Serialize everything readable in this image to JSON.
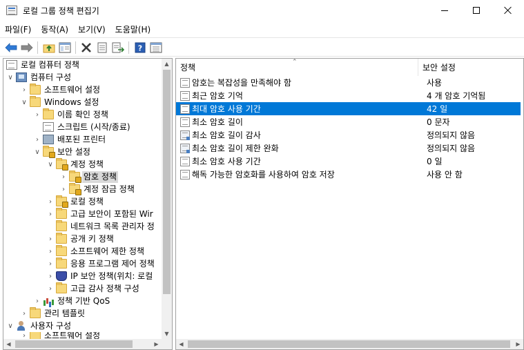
{
  "window": {
    "title": "로컬 그룹 정책 편집기",
    "icon": "group-policy-editor-icon",
    "controls": [
      "minimize-icon",
      "maximize-icon",
      "close-icon"
    ]
  },
  "menu": [
    "파일(F)",
    "동작(A)",
    "보기(V)",
    "도움말(H)"
  ],
  "toolbar": {
    "icons": [
      "back-arrow-icon",
      "forward-arrow-icon",
      "up-folder-icon",
      "show-hide-tree-icon",
      "delete-icon",
      "properties-icon",
      "export-list-icon",
      "help-icon",
      "view-icon"
    ],
    "colors": {
      "back": "#2f7ad6",
      "forward": "#7f7f7f",
      "delete": "#3a3a3a",
      "help": "#2b5fb4"
    }
  },
  "tree": [
    {
      "label": "로컬 컴퓨터 정책",
      "icon": "policy-document-icon",
      "arrow": ""
    },
    {
      "label": "컴퓨터 구성",
      "icon": "computer-icon",
      "arrow": "expanded"
    },
    {
      "label": "소프트웨어 설정",
      "icon": "folder-icon",
      "arrow": "collapsed"
    },
    {
      "label": "Windows 설정",
      "icon": "folder-icon",
      "arrow": "expanded"
    },
    {
      "label": "이름 확인 정책",
      "icon": "folder-icon",
      "arrow": "collapsed"
    },
    {
      "label": "스크립트 (시작/종료)",
      "icon": "script-document-icon",
      "arrow": ""
    },
    {
      "label": "배포된 프린터",
      "icon": "printer-icon",
      "arrow": "collapsed"
    },
    {
      "label": "보안 설정",
      "icon": "security-folder-icon",
      "arrow": "expanded"
    },
    {
      "label": "계정 정책",
      "icon": "locked-folder-icon",
      "arrow": "expanded"
    },
    {
      "label": "암호 정책",
      "icon": "locked-folder-icon",
      "arrow": "collapsed",
      "selected": true
    },
    {
      "label": "계정 잠금 정책",
      "icon": "locked-folder-icon",
      "arrow": "collapsed"
    },
    {
      "label": "로컬 정책",
      "icon": "locked-folder-icon",
      "arrow": "collapsed"
    },
    {
      "label": "고급 보안이 포함된 Wir",
      "icon": "folder-icon",
      "arrow": "collapsed"
    },
    {
      "label": "네트워크 목록 관리자 정",
      "icon": "folder-icon",
      "arrow": ""
    },
    {
      "label": "공개 키 정책",
      "icon": "folder-icon",
      "arrow": "collapsed"
    },
    {
      "label": "소프트웨어 제한 정책",
      "icon": "folder-icon",
      "arrow": "collapsed"
    },
    {
      "label": "응용 프로그램 제어 정책",
      "icon": "folder-icon",
      "arrow": "collapsed"
    },
    {
      "label": "IP 보안 정책(위치: 로컬",
      "icon": "ip-security-shield-icon",
      "arrow": "collapsed"
    },
    {
      "label": "고급 감사 정책 구성",
      "icon": "folder-icon",
      "arrow": "collapsed"
    },
    {
      "label": "정책 기반 QoS",
      "icon": "bar-chart-icon",
      "arrow": "collapsed"
    },
    {
      "label": "관리 템플릿",
      "icon": "folder-icon",
      "arrow": "collapsed"
    },
    {
      "label": "사용자 구성",
      "icon": "user-icon",
      "arrow": "expanded"
    },
    {
      "label": "소프트웨어 설정",
      "icon": "folder-icon",
      "arrow": "collapsed"
    }
  ],
  "list": {
    "columns": [
      "정책",
      "보안 설정"
    ],
    "rows": [
      {
        "policy": "암호는 복잡성을 만족해야 함",
        "setting": "사용",
        "icon": "policy-item-icon"
      },
      {
        "policy": "최근 암호 기억",
        "setting": "4 개 암호 기억됨",
        "icon": "policy-item-icon"
      },
      {
        "policy": "최대 암호 사용 기간",
        "setting": "42 일",
        "icon": "policy-item-icon",
        "selected": true
      },
      {
        "policy": "최소 암호 길이",
        "setting": "0 문자",
        "icon": "policy-item-icon"
      },
      {
        "policy": "최소 암호 길이 감사",
        "setting": "정의되지 않음",
        "icon": "audit-policy-icon"
      },
      {
        "policy": "최소 암호 길이 제한 완화",
        "setting": "정의되지 않음",
        "icon": "audit-policy-icon"
      },
      {
        "policy": "최소 암호 사용 기간",
        "setting": "0 일",
        "icon": "policy-item-icon"
      },
      {
        "policy": "해독 가능한 암호화를 사용하여 암호 저장",
        "setting": "사용 안 함",
        "icon": "policy-item-icon"
      }
    ]
  },
  "colors": {
    "selection": "#0078d7",
    "tree_selection": "#d9d9d9",
    "border": "#a0a0a0"
  }
}
